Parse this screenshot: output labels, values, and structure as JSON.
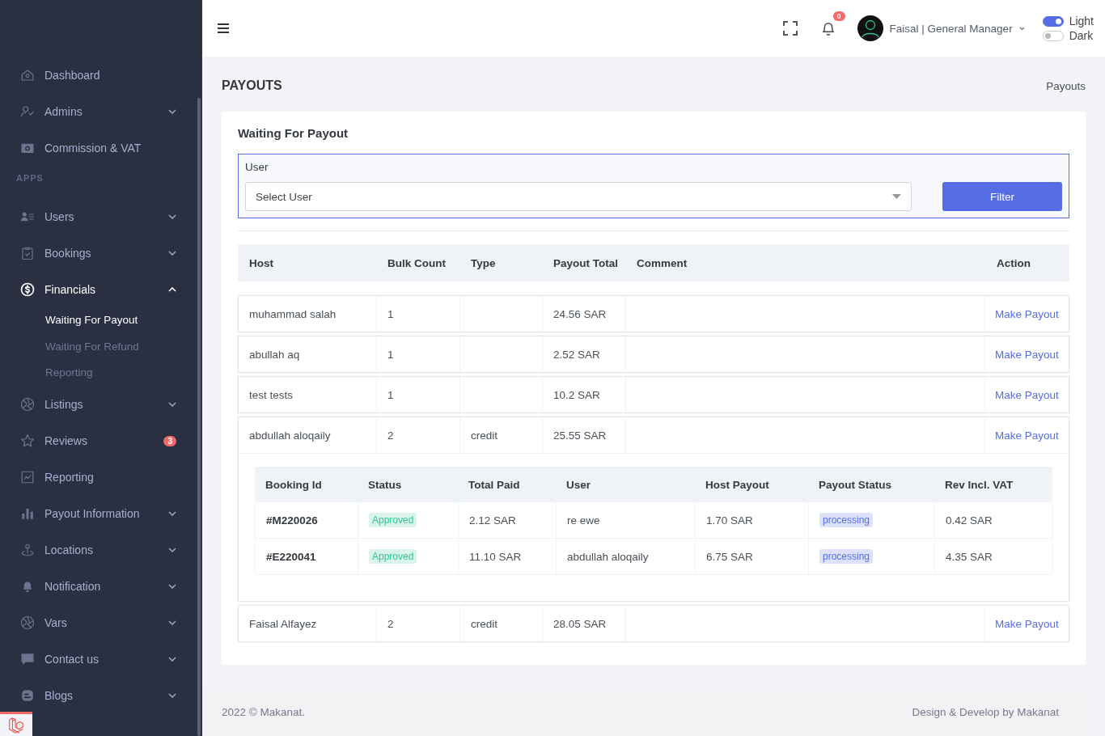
{
  "sidebar": {
    "items": [
      {
        "kind": "link",
        "label": "Dashboard"
      },
      {
        "kind": "link",
        "label": "Admins",
        "expanded": false
      },
      {
        "kind": "link",
        "label": "Commission & VAT"
      },
      {
        "kind": "heading",
        "label": "APPS"
      },
      {
        "kind": "link",
        "label": "Users",
        "expanded": false
      },
      {
        "kind": "link",
        "label": "Bookings",
        "expanded": false
      },
      {
        "kind": "link",
        "label": "Financials",
        "expanded": true,
        "selected": true,
        "children": [
          {
            "label": "Waiting For Payout",
            "selected": true
          },
          {
            "label": "Waiting For Refund",
            "selected": false
          },
          {
            "label": "Reporting",
            "selected": false
          }
        ]
      },
      {
        "kind": "link",
        "label": "Listings",
        "expanded": false
      },
      {
        "kind": "link",
        "label": "Reviews",
        "badge": "3"
      },
      {
        "kind": "link",
        "label": "Reporting"
      },
      {
        "kind": "link",
        "label": "Payout Information",
        "expanded": false
      },
      {
        "kind": "link",
        "label": "Locations",
        "expanded": false
      },
      {
        "kind": "link",
        "label": "Notification",
        "expanded": false
      },
      {
        "kind": "link",
        "label": "Vars",
        "expanded": false
      },
      {
        "kind": "link",
        "label": "Contact us",
        "expanded": false
      },
      {
        "kind": "link",
        "label": "Blogs",
        "expanded": false
      }
    ]
  },
  "topbar": {
    "notification_count": "0",
    "user": "Faisal | General Manager",
    "theme_switches": [
      {
        "label": "Light",
        "on": true
      },
      {
        "label": "Dark",
        "on": false
      }
    ]
  },
  "page": {
    "title": "PAYOUTS",
    "breadcrumb": "Payouts"
  },
  "card": {
    "title": "Waiting For Payout",
    "filter": {
      "label": "User",
      "select_placeholder": "Select User",
      "button": "Filter"
    },
    "table": {
      "columns": [
        "Host",
        "Bulk Count",
        "Type",
        "Payout Total",
        "Comment",
        "Action"
      ],
      "rows": [
        {
          "host": "muhammad salah",
          "bulk_count": "1",
          "payout_total": "24.56 SAR",
          "action": "Make Payout"
        },
        {
          "host": "abullah aq",
          "bulk_count": "1",
          "payout_total": "2.52 SAR",
          "action": "Make Payout"
        },
        {
          "host": "test tests",
          "bulk_count": "1",
          "payout_total": "10.2 SAR",
          "action": "Make Payout"
        },
        {
          "host": "abdullah aloqaily",
          "bulk_count": "2",
          "type": "credit",
          "payout_total": "25.55 SAR",
          "action": "Make Payout",
          "details": {
            "columns": [
              "Booking Id",
              "Status",
              "Total Paid",
              "User",
              "Host Payout",
              "Payout Status",
              "Rev Incl. VAT"
            ],
            "rows": [
              [
                {
                  "kind": "bold",
                  "text": "#M220026"
                },
                {
                  "kind": "success",
                  "text": "Approved"
                },
                {
                  "kind": "plain",
                  "text": "2.12 SAR"
                },
                {
                  "kind": "plain",
                  "text": "re ewe"
                },
                {
                  "kind": "plain",
                  "text": "1.70 SAR"
                },
                {
                  "kind": "info",
                  "text": "processing"
                },
                {
                  "kind": "plain",
                  "text": "0.42 SAR"
                }
              ],
              [
                {
                  "kind": "bold",
                  "text": "#E220041"
                },
                {
                  "kind": "success",
                  "text": "Approved"
                },
                {
                  "kind": "plain",
                  "text": "11.10 SAR"
                },
                {
                  "kind": "plain",
                  "text": "abdullah aloqaily"
                },
                {
                  "kind": "plain",
                  "text": "6.75 SAR"
                },
                {
                  "kind": "info",
                  "text": "processing"
                },
                {
                  "kind": "plain",
                  "text": "4.35 SAR"
                }
              ]
            ]
          }
        },
        {
          "host": "Faisal Alfayez",
          "bulk_count": "2",
          "type": "credit",
          "payout_total": "28.05 SAR",
          "action": "Make Payout"
        }
      ]
    }
  },
  "footer": {
    "copyright": "2022 © Makanat.",
    "credit": "Design & Develop by Makanat"
  }
}
